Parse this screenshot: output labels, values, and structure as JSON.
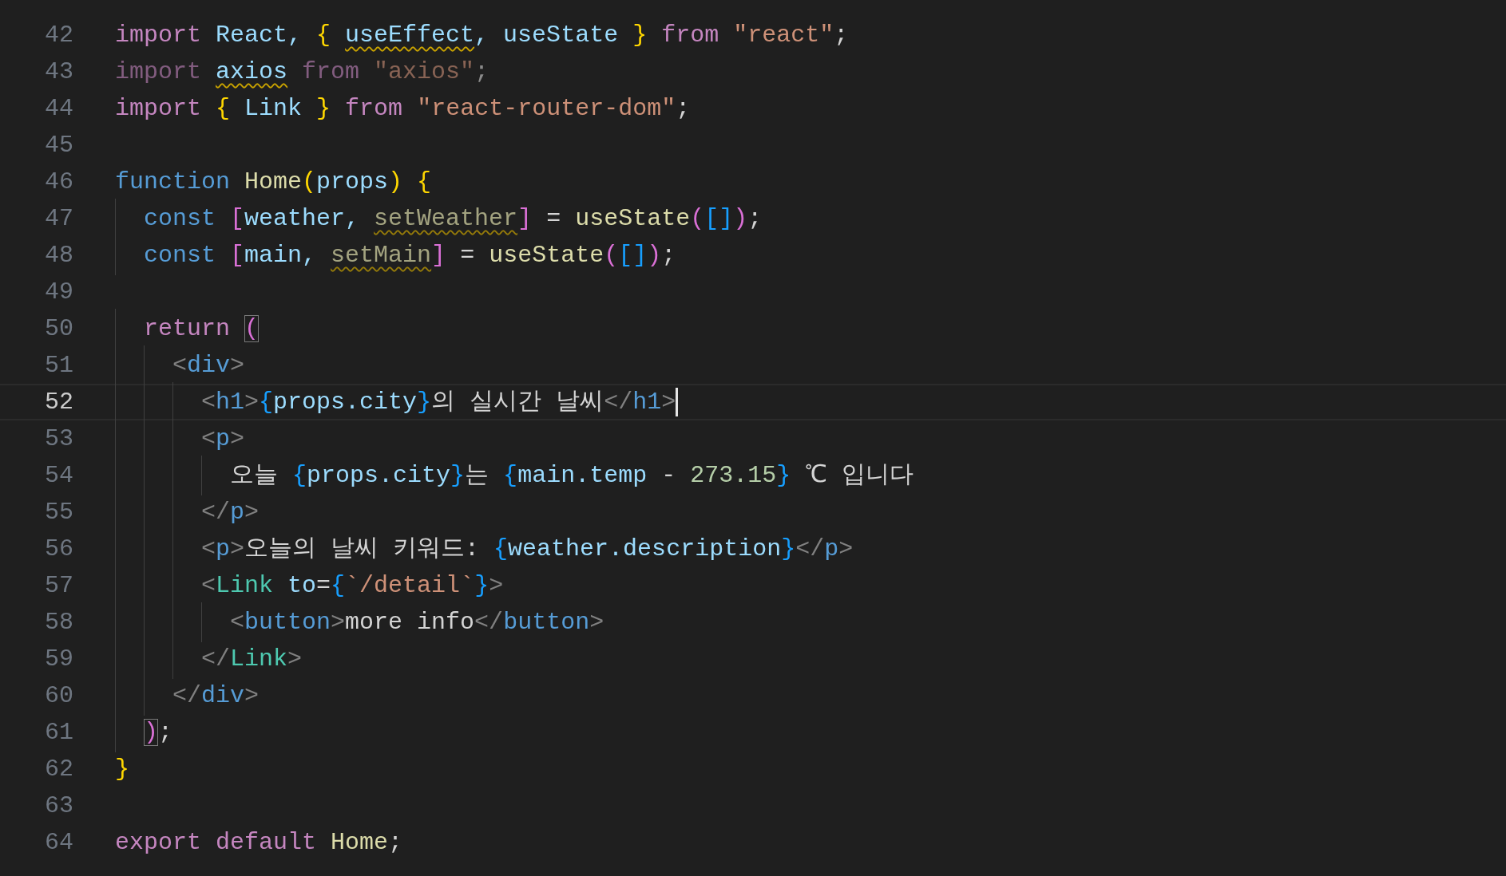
{
  "editor": {
    "lines": [
      {
        "number": "42",
        "current": false,
        "tokens": [
          {
            "text": "import",
            "kind": "kw"
          },
          {
            "text": " React, ",
            "kind": "var"
          },
          {
            "text": "{ ",
            "kind": "b1"
          },
          {
            "text": "useEffect",
            "kind": "warn-var"
          },
          {
            "text": ", useState ",
            "kind": "var"
          },
          {
            "text": "}",
            "kind": "b1"
          },
          {
            "text": " from ",
            "kind": "kw"
          },
          {
            "text": "\"react\"",
            "kind": "str"
          },
          {
            "text": ";",
            "kind": "plain"
          }
        ]
      },
      {
        "number": "43",
        "current": false,
        "tokens": [
          {
            "text": "import ",
            "kind": "faded-kw"
          },
          {
            "text": "axios",
            "kind": "warn-var"
          },
          {
            "text": " from ",
            "kind": "faded-kw"
          },
          {
            "text": "\"axios\"",
            "kind": "faded-str"
          },
          {
            "text": ";",
            "kind": "faded-plain"
          }
        ]
      },
      {
        "number": "44",
        "current": false,
        "tokens": [
          {
            "text": "import ",
            "kind": "kw"
          },
          {
            "text": "{",
            "kind": "b1"
          },
          {
            "text": " Link ",
            "kind": "var"
          },
          {
            "text": "}",
            "kind": "b1"
          },
          {
            "text": " from ",
            "kind": "kw"
          },
          {
            "text": "\"react-router-dom\"",
            "kind": "str"
          },
          {
            "text": ";",
            "kind": "plain"
          }
        ]
      },
      {
        "number": "45",
        "current": false
      },
      {
        "number": "46",
        "current": false,
        "tokens": [
          {
            "text": "function ",
            "kind": "storage"
          },
          {
            "text": "Home",
            "kind": "fn"
          },
          {
            "text": "(",
            "kind": "b1"
          },
          {
            "text": "props",
            "kind": "var"
          },
          {
            "text": ") ",
            "kind": "b1"
          },
          {
            "text": "{",
            "kind": "b1"
          }
        ]
      },
      {
        "number": "47",
        "current": false,
        "tokens": [
          {
            "text": "  const ",
            "kind": "storage"
          },
          {
            "text": "[",
            "kind": "b2"
          },
          {
            "text": "weather, ",
            "kind": "var"
          },
          {
            "text": "setWeather",
            "kind": "warn-fn"
          },
          {
            "text": "]",
            "kind": "b2"
          },
          {
            "text": " = ",
            "kind": "plain"
          },
          {
            "text": "useState",
            "kind": "fn"
          },
          {
            "text": "(",
            "kind": "b2"
          },
          {
            "text": "[]",
            "kind": "b3"
          },
          {
            "text": ")",
            "kind": "b2"
          },
          {
            "text": ";",
            "kind": "plain"
          }
        ]
      },
      {
        "number": "48",
        "current": false,
        "tokens": [
          {
            "text": "  const ",
            "kind": "storage"
          },
          {
            "text": "[",
            "kind": "b2"
          },
          {
            "text": "main, ",
            "kind": "var"
          },
          {
            "text": "setMain",
            "kind": "warn-fn"
          },
          {
            "text": "]",
            "kind": "b2"
          },
          {
            "text": " = ",
            "kind": "plain"
          },
          {
            "text": "useState",
            "kind": "fn"
          },
          {
            "text": "(",
            "kind": "b2"
          },
          {
            "text": "[]",
            "kind": "b3"
          },
          {
            "text": ")",
            "kind": "b2"
          },
          {
            "text": ";",
            "kind": "plain"
          }
        ]
      },
      {
        "number": "49",
        "current": false
      },
      {
        "number": "50",
        "current": false,
        "tokens": [
          {
            "text": "  return ",
            "kind": "kw"
          },
          {
            "text": "(",
            "kind": "match"
          }
        ]
      },
      {
        "number": "51",
        "current": false,
        "tokens": [
          {
            "text": "    <",
            "kind": "punct"
          },
          {
            "text": "div",
            "kind": "tag"
          },
          {
            "text": ">",
            "kind": "punct"
          }
        ]
      },
      {
        "number": "52",
        "current": true,
        "tokens": [
          {
            "text": "      <",
            "kind": "punct"
          },
          {
            "text": "h1",
            "kind": "tag"
          },
          {
            "text": ">",
            "kind": "punct"
          },
          {
            "text": "{",
            "kind": "b3"
          },
          {
            "text": "props.city",
            "kind": "var"
          },
          {
            "text": "}",
            "kind": "b3"
          },
          {
            "text": "의 실시간 날씨",
            "kind": "plain"
          },
          {
            "text": "</",
            "kind": "punct"
          },
          {
            "text": "h1",
            "kind": "tag"
          },
          {
            "text": ">",
            "kind": "punct"
          }
        ]
      },
      {
        "number": "53",
        "current": false,
        "tokens": [
          {
            "text": "      <",
            "kind": "punct"
          },
          {
            "text": "p",
            "kind": "tag"
          },
          {
            "text": ">",
            "kind": "punct"
          }
        ]
      },
      {
        "number": "54",
        "current": false,
        "tokens": [
          {
            "text": "        오늘 ",
            "kind": "plain"
          },
          {
            "text": "{",
            "kind": "b3"
          },
          {
            "text": "props.city",
            "kind": "var"
          },
          {
            "text": "}",
            "kind": "b3"
          },
          {
            "text": "는 ",
            "kind": "plain"
          },
          {
            "text": "{",
            "kind": "b3"
          },
          {
            "text": "main.temp",
            "kind": "var"
          },
          {
            "text": " - ",
            "kind": "plain"
          },
          {
            "text": "273.15",
            "kind": "num"
          },
          {
            "text": "}",
            "kind": "b3"
          },
          {
            "text": " ℃ 입니다",
            "kind": "plain"
          }
        ]
      },
      {
        "number": "55",
        "current": false,
        "tokens": [
          {
            "text": "      </",
            "kind": "punct"
          },
          {
            "text": "p",
            "kind": "tag"
          },
          {
            "text": ">",
            "kind": "punct"
          }
        ]
      },
      {
        "number": "56",
        "current": false,
        "tokens": [
          {
            "text": "      <",
            "kind": "punct"
          },
          {
            "text": "p",
            "kind": "tag"
          },
          {
            "text": ">",
            "kind": "punct"
          },
          {
            "text": "오늘의 날씨 키워드: ",
            "kind": "plain"
          },
          {
            "text": "{",
            "kind": "b3"
          },
          {
            "text": "weather.description",
            "kind": "var"
          },
          {
            "text": "}",
            "kind": "b3"
          },
          {
            "text": "</",
            "kind": "punct"
          },
          {
            "text": "p",
            "kind": "tag"
          },
          {
            "text": ">",
            "kind": "punct"
          }
        ]
      },
      {
        "number": "57",
        "current": false,
        "tokens": [
          {
            "text": "      <",
            "kind": "punct"
          },
          {
            "text": "Link",
            "kind": "component"
          },
          {
            "text": " to",
            "kind": "var"
          },
          {
            "text": "=",
            "kind": "plain"
          },
          {
            "text": "{",
            "kind": "b3"
          },
          {
            "text": "`/detail`",
            "kind": "str"
          },
          {
            "text": "}",
            "kind": "b3"
          },
          {
            "text": ">",
            "kind": "punct"
          }
        ]
      },
      {
        "number": "58",
        "current": false,
        "tokens": [
          {
            "text": "        <",
            "kind": "punct"
          },
          {
            "text": "button",
            "kind": "tag"
          },
          {
            "text": ">",
            "kind": "punct"
          },
          {
            "text": "more info",
            "kind": "plain"
          },
          {
            "text": "</",
            "kind": "punct"
          },
          {
            "text": "button",
            "kind": "tag"
          },
          {
            "text": ">",
            "kind": "punct"
          }
        ]
      },
      {
        "number": "59",
        "current": false,
        "tokens": [
          {
            "text": "      </",
            "kind": "punct"
          },
          {
            "text": "Link",
            "kind": "component"
          },
          {
            "text": ">",
            "kind": "punct"
          }
        ]
      },
      {
        "number": "60",
        "current": false,
        "tokens": [
          {
            "text": "    </",
            "kind": "punct"
          },
          {
            "text": "div",
            "kind": "tag"
          },
          {
            "text": ">",
            "kind": "punct"
          }
        ]
      },
      {
        "number": "61",
        "current": false,
        "tokens": [
          {
            "text": "  )",
            "kind": "match"
          },
          {
            "text": ";",
            "kind": "plain"
          }
        ]
      },
      {
        "number": "62",
        "current": false,
        "tokens": [
          {
            "text": "}",
            "kind": "b1"
          }
        ]
      },
      {
        "number": "63",
        "current": false
      },
      {
        "number": "64",
        "current": false,
        "tokens": [
          {
            "text": "export default ",
            "kind": "kw"
          },
          {
            "text": "Home",
            "kind": "fn"
          },
          {
            "text": ";",
            "kind": "plain"
          }
        ]
      }
    ]
  }
}
